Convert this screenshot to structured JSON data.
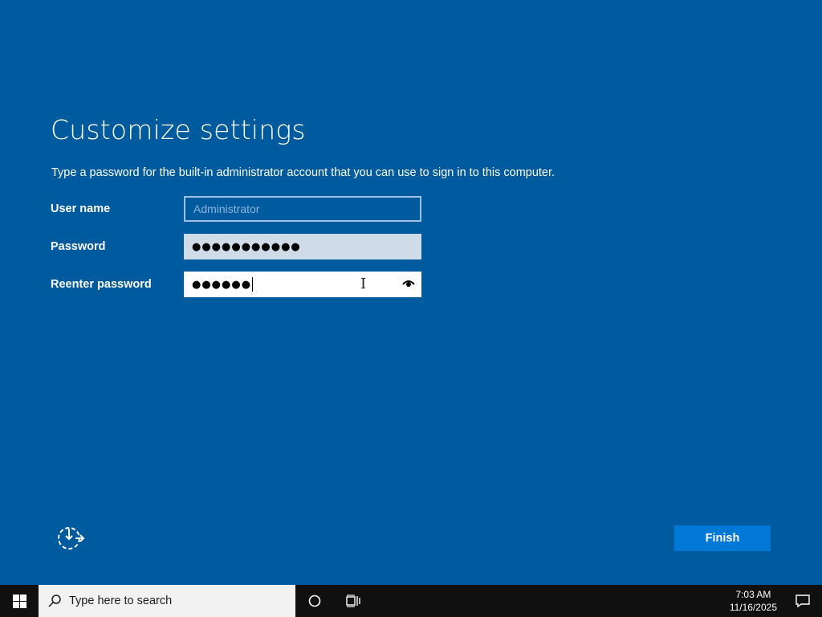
{
  "page": {
    "title": "Customize settings",
    "description": "Type a password for the built-in administrator account that you can use to sign in to this computer."
  },
  "form": {
    "username_label": "User name",
    "username_placeholder": "Administrator",
    "password_label": "Password",
    "password_value": "●●●●●●●●●●●",
    "reenter_label": "Reenter password",
    "reenter_value": "●●●●●●"
  },
  "actions": {
    "finish_label": "Finish"
  },
  "icons": {
    "ease_of_access": "ease-of-access-icon",
    "reveal_password": "eye-icon",
    "start": "windows-logo-icon",
    "search": "search-icon",
    "cortana": "cortana-circle-icon",
    "task_view": "task-view-icon",
    "notifications": "action-center-icon"
  },
  "taskbar": {
    "search_placeholder": "Type here to search",
    "time": "7:03 AM",
    "date": "11/16/2025"
  },
  "colors": {
    "background": "#005a9e",
    "accent": "#0078d7",
    "taskbar": "#101010"
  }
}
